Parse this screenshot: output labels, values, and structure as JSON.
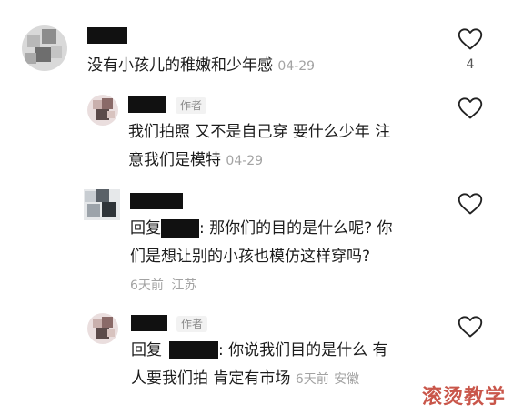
{
  "comments": [
    {
      "text": "没有小孩儿的稚嫩和少年感",
      "date": "04-29",
      "likes": "4"
    },
    {
      "author_tag": "作者",
      "text_line1": "我们拍照 又不是自己穿 要什么少年 注",
      "text_line2": "意我们是模特",
      "date": "04-29"
    },
    {
      "reply_prefix": "回复",
      "text_line1_tail": ": 那你们的目的是什么呢? 你",
      "text_line2": "们是想让别的小孩也模仿这样穿吗?",
      "meta_date": "6天前",
      "meta_location": "江苏"
    },
    {
      "author_tag": "作者",
      "reply_prefix": "回复",
      "text_line1_tail": ": 你说我们目的是什么 有",
      "text_line2": "人要我们拍 肯定有市场",
      "meta_date": "6天前",
      "meta_location": "安徽"
    }
  ],
  "watermark": "滚烫教学",
  "icons": {
    "like": "heart-outline-icon"
  },
  "colors": {
    "text": "#1c1c1c",
    "meta": "#a3a3a3",
    "watermark": "#c0392b"
  }
}
